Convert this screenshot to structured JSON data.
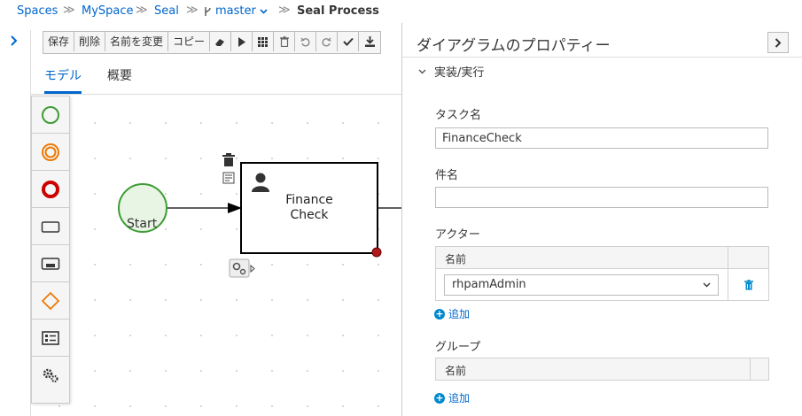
{
  "breadcrumb": {
    "spaces": "Spaces",
    "myspace": "MySpace",
    "project": "Seal",
    "branch": "master",
    "current": "Seal Process"
  },
  "toolbar": {
    "save": "保存",
    "delete": "削除",
    "rename": "名前を変更",
    "copy": "コピー"
  },
  "tabs": {
    "model": "モデル",
    "overview": "概要"
  },
  "diagram": {
    "start_label": "Start",
    "task_line1": "Finance",
    "task_line2": "Check"
  },
  "panel": {
    "title": "ダイアグラムのプロパティー",
    "section": "実装/実行",
    "task_name_label": "タスク名",
    "task_name_value": "FinanceCheck",
    "subject_label": "件名",
    "subject_value": "",
    "actors_label": "アクター",
    "actors_col_name": "名前",
    "actor_value": "rhpamAdmin",
    "add_label": "追加",
    "groups_label": "グループ",
    "groups_col_name": "名前",
    "add_label2": "追加"
  },
  "colors": {
    "accent": "#0066cc",
    "start_event": "#3f9c35",
    "intermediate_event": "#ec7a08",
    "end_event": "#cc0000"
  }
}
